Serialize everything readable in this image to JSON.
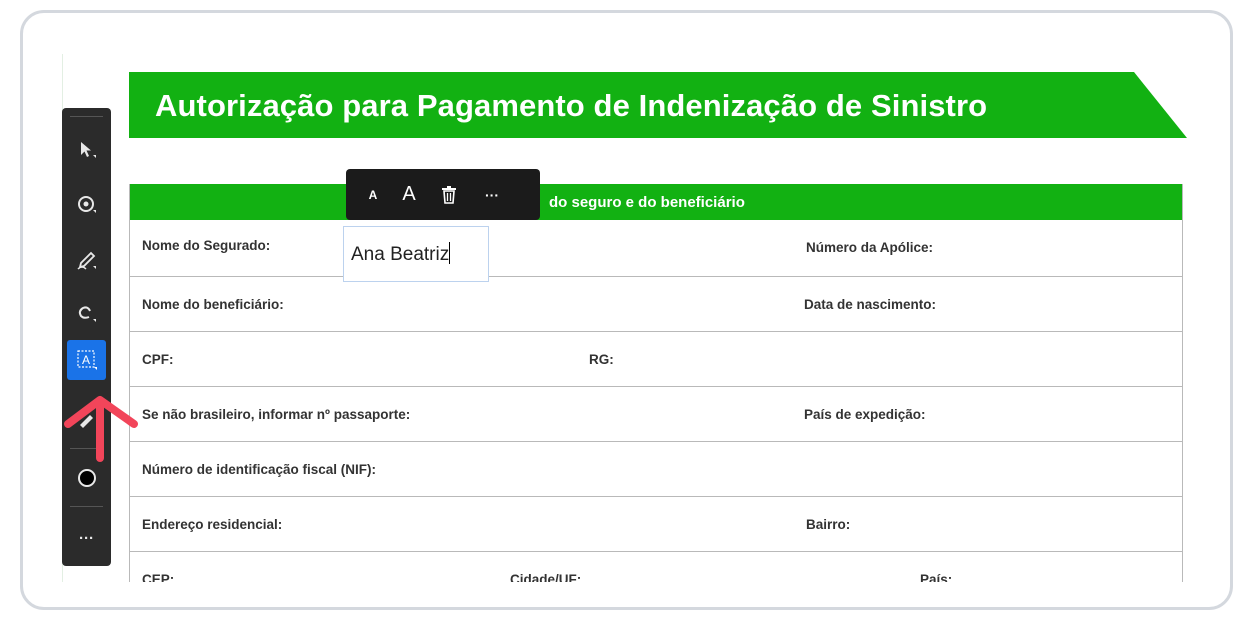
{
  "document": {
    "title": "Autorização para Pagamento de Indenização de Sinistro",
    "section_title": "do seguro e do beneficiário",
    "rows": [
      {
        "labels": [
          "Nome do Segurado:",
          "Número da Apólice:"
        ]
      },
      {
        "labels": [
          "Nome do beneficiário:",
          "Data de nascimento:"
        ]
      },
      {
        "labels": [
          "CPF:",
          "RG:"
        ]
      },
      {
        "labels": [
          "Se não brasileiro, informar nº passaporte:",
          "País de expedição:"
        ]
      },
      {
        "labels": [
          "Número de identificação fiscal (NIF):"
        ]
      },
      {
        "labels": [
          "Endereço residencial:",
          "Bairro:"
        ]
      },
      {
        "labels": [
          "CEP:",
          "Cidade/UF:",
          "País:"
        ]
      }
    ]
  },
  "text_field": {
    "value": "Ana Beatriz"
  },
  "text_toolbar": {
    "small_font_label": "A",
    "large_font_label": "A",
    "delete_icon": "trash-icon",
    "more_label": "···"
  },
  "side_toolbar": {
    "more_label": "···",
    "tools": [
      "select-arrow-icon",
      "annotate-icon",
      "sign-pen-icon",
      "lasso-icon",
      "text-box-icon",
      "highlighter-icon",
      "color-swatch-icon",
      "more-icon"
    ],
    "active_tool": "text-box-icon",
    "text_tool_glyph": "A"
  },
  "colors": {
    "brand_green": "#12b112",
    "active_blue": "#1a73e8",
    "annotation_arrow": "#f2455a"
  }
}
